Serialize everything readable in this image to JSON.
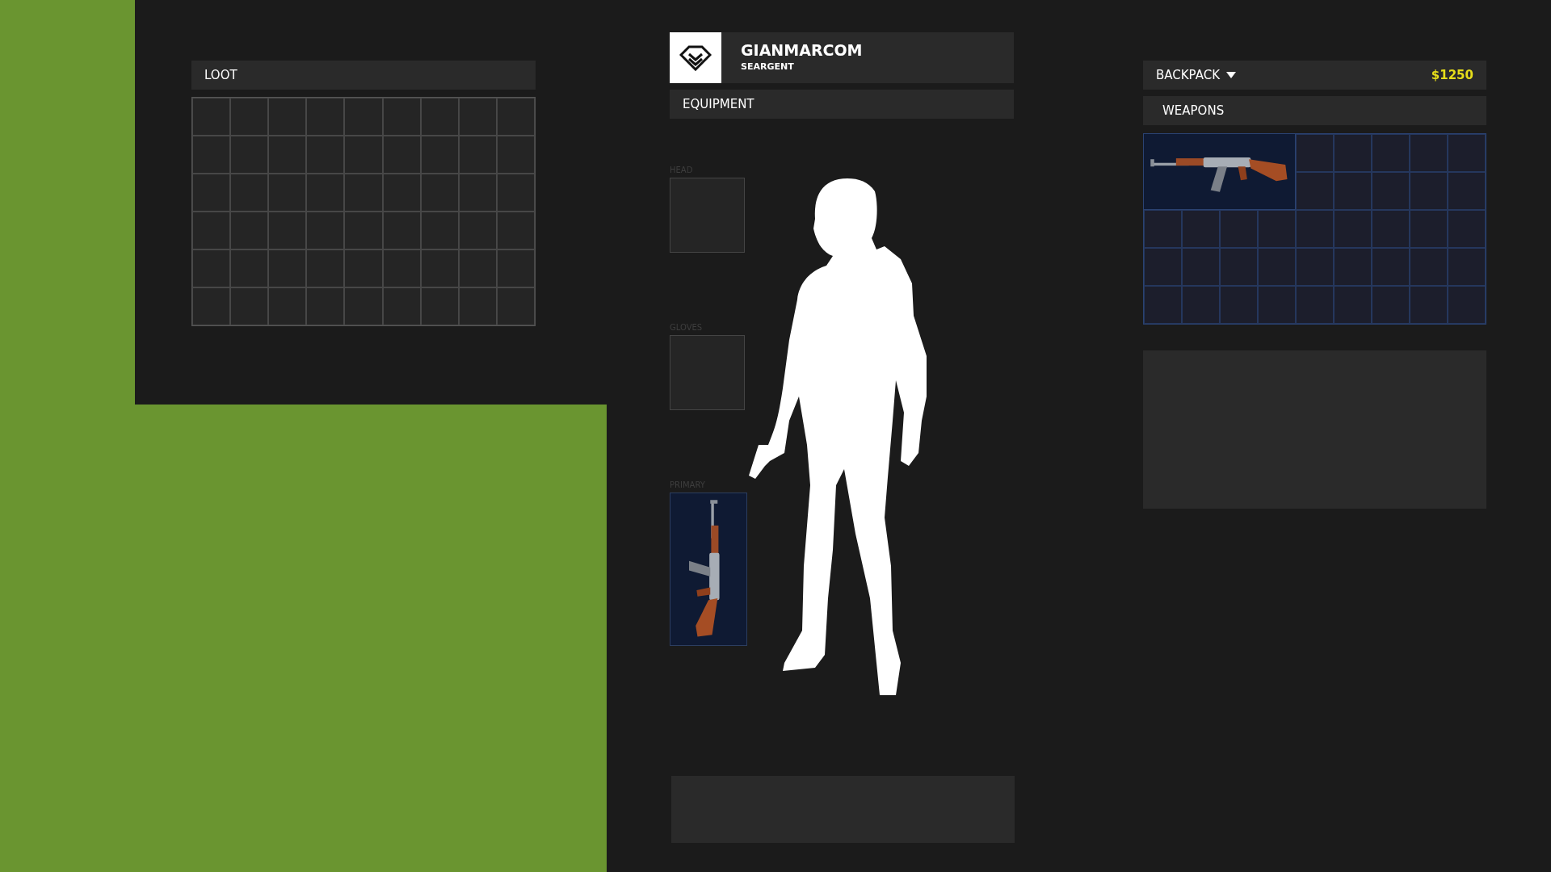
{
  "loot": {
    "title": "LOOT"
  },
  "player": {
    "name": "GIANMARCOM",
    "rank": "SEARGENT"
  },
  "equipment": {
    "title": "EQUIPMENT",
    "slots": [
      {
        "label": "HEAD",
        "kind": "empty"
      },
      {
        "label": "GLOVES",
        "kind": "empty"
      },
      {
        "label": "PRIMARY",
        "kind": "weapon"
      }
    ]
  },
  "backpack": {
    "title": "BACKPACK",
    "money": "$1250",
    "category": "WEAPONS"
  }
}
